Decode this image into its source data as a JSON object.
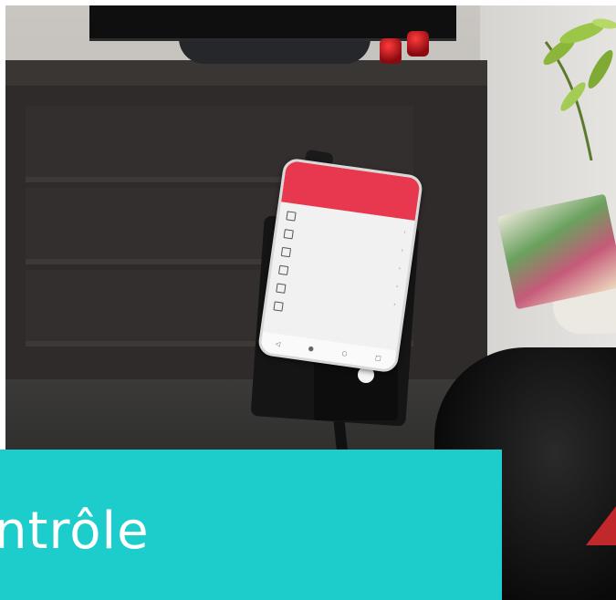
{
  "banner": {
    "text": "ntrôle",
    "color": "#1ccdcc"
  },
  "phone_app": {
    "accent_color": "#e8384f",
    "menu_icons": [
      "living-room-icon",
      "bedroom-icon",
      "door-icon",
      "kitchen-icon",
      "bulb-icon",
      "lock-icon"
    ],
    "nav_icons": [
      "back-icon",
      "mic-icon",
      "home-icon",
      "recent-icon"
    ]
  }
}
